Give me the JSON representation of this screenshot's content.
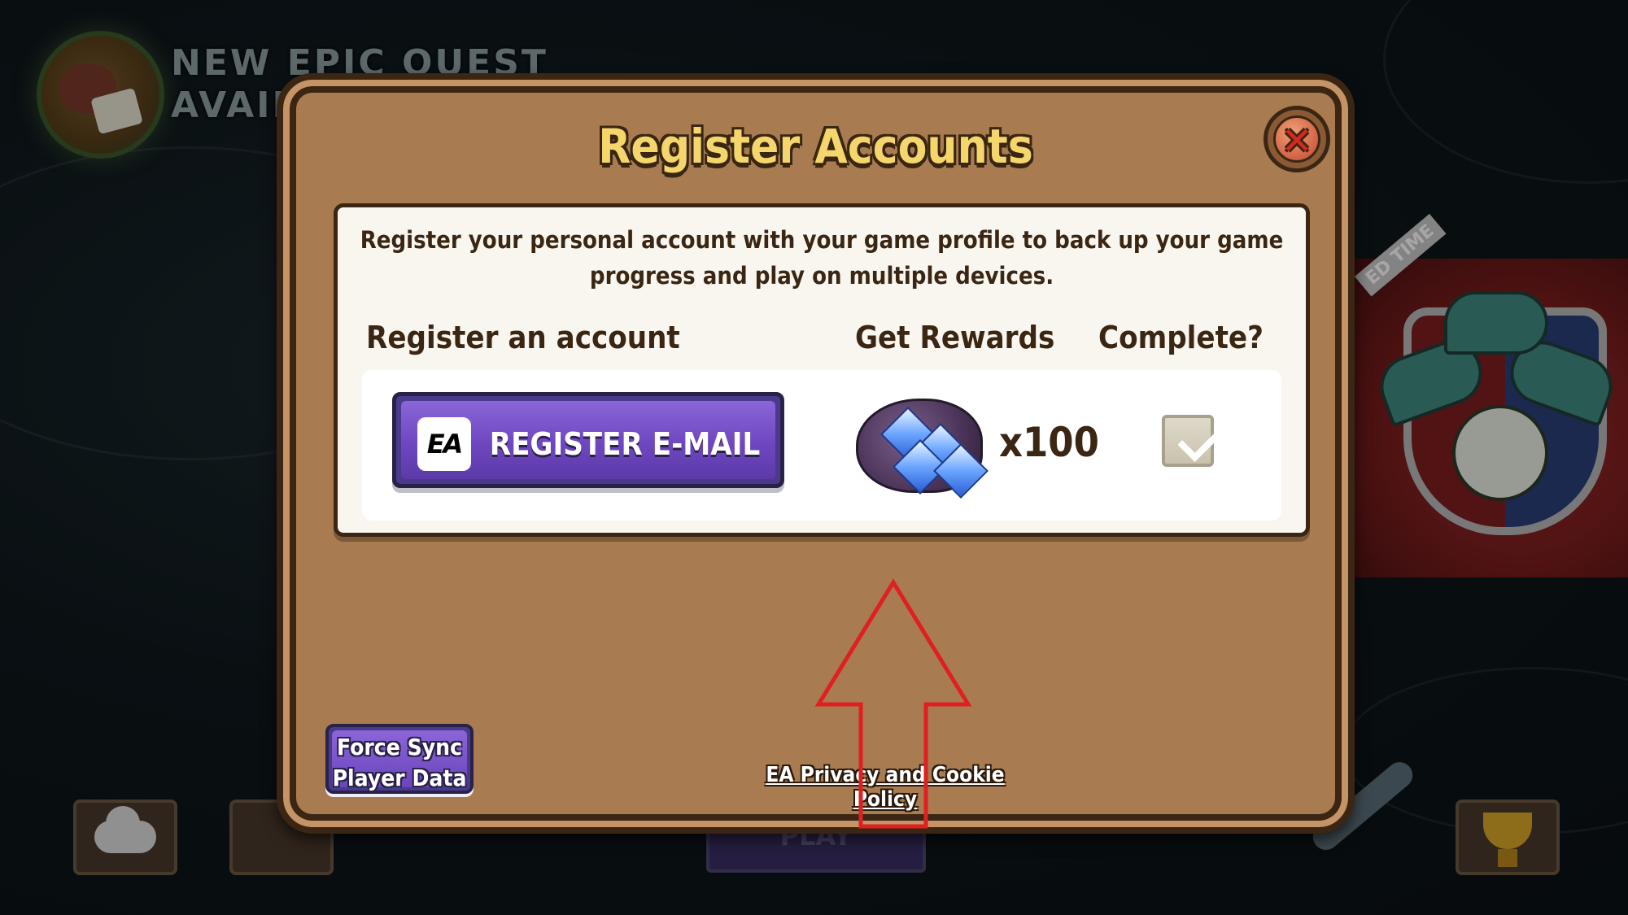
{
  "background": {
    "quest_banner": "NEW EPIC QUEST\nAVAILA",
    "event_banner": "ED TIME",
    "play_label": "PLAY"
  },
  "dialog": {
    "title": "Register Accounts",
    "close_icon": "close-x-icon",
    "intro": "Register your personal account with your game profile to back up your game progress and play on multiple devices.",
    "columns": {
      "register": "Register an account",
      "rewards": "Get Rewards",
      "complete": "Complete?"
    },
    "register_button": {
      "logo_text": "EA",
      "label": "REGISTER E-MAIL"
    },
    "reward": {
      "icon": "gem-bag-icon",
      "count": "x100"
    },
    "complete_checked": true,
    "force_sync_label": "Force Sync Player Data",
    "privacy_link": "EA Privacy and Cookie Policy"
  },
  "colors": {
    "dialog_bg": "#a97b51",
    "title": "#f5d66c",
    "button_purple": "#6e47c0",
    "annotation_arrow": "#e02020"
  }
}
